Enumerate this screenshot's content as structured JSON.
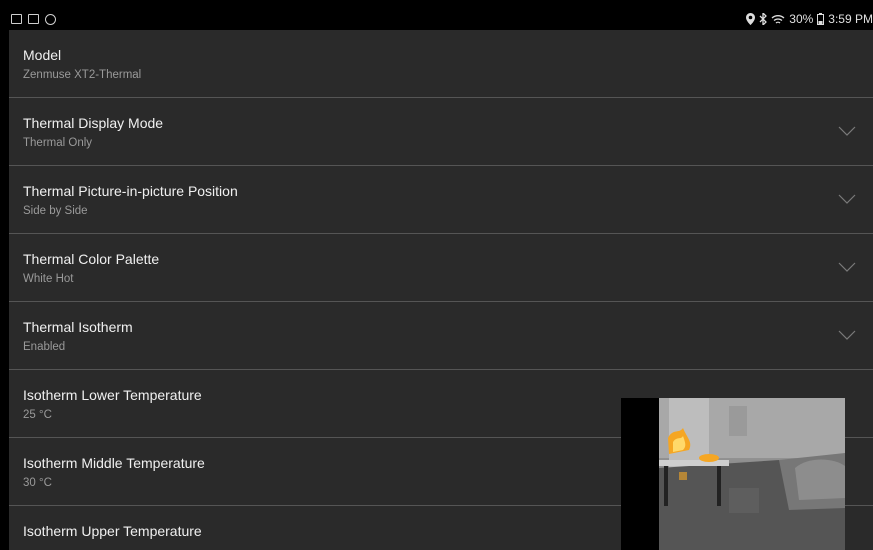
{
  "status_bar": {
    "left_icons": [
      "image-icon",
      "cast-icon",
      "sync-icon"
    ],
    "right_icons": [
      "location-icon",
      "bluetooth-icon",
      "wifi-icon",
      "battery-icon"
    ],
    "battery": "30%",
    "time": "3:59 PM"
  },
  "settings": [
    {
      "title": "Model",
      "value": "Zenmuse XT2-Thermal",
      "has_dropdown": false
    },
    {
      "title": "Thermal Display Mode",
      "value": "Thermal Only",
      "has_dropdown": true
    },
    {
      "title": "Thermal Picture-in-picture Position",
      "value": "Side by Side",
      "has_dropdown": true
    },
    {
      "title": "Thermal Color Palette",
      "value": "White Hot",
      "has_dropdown": true
    },
    {
      "title": "Thermal Isotherm",
      "value": "Enabled",
      "has_dropdown": true
    },
    {
      "title": "Isotherm Lower Temperature",
      "value": "25 °C",
      "has_dropdown": false
    },
    {
      "title": "Isotherm Middle Temperature",
      "value": "30 °C",
      "has_dropdown": false
    },
    {
      "title": "Isotherm Upper Temperature",
      "value": "",
      "has_dropdown": false
    }
  ],
  "colors": {
    "panel_bg": "#2a2a2a",
    "divider": "#555555",
    "title_text": "#f0f0f0",
    "subtitle_text": "#9a9a9a",
    "chevron": "#7a7a7a",
    "isotherm_hot": "#f5a623"
  }
}
